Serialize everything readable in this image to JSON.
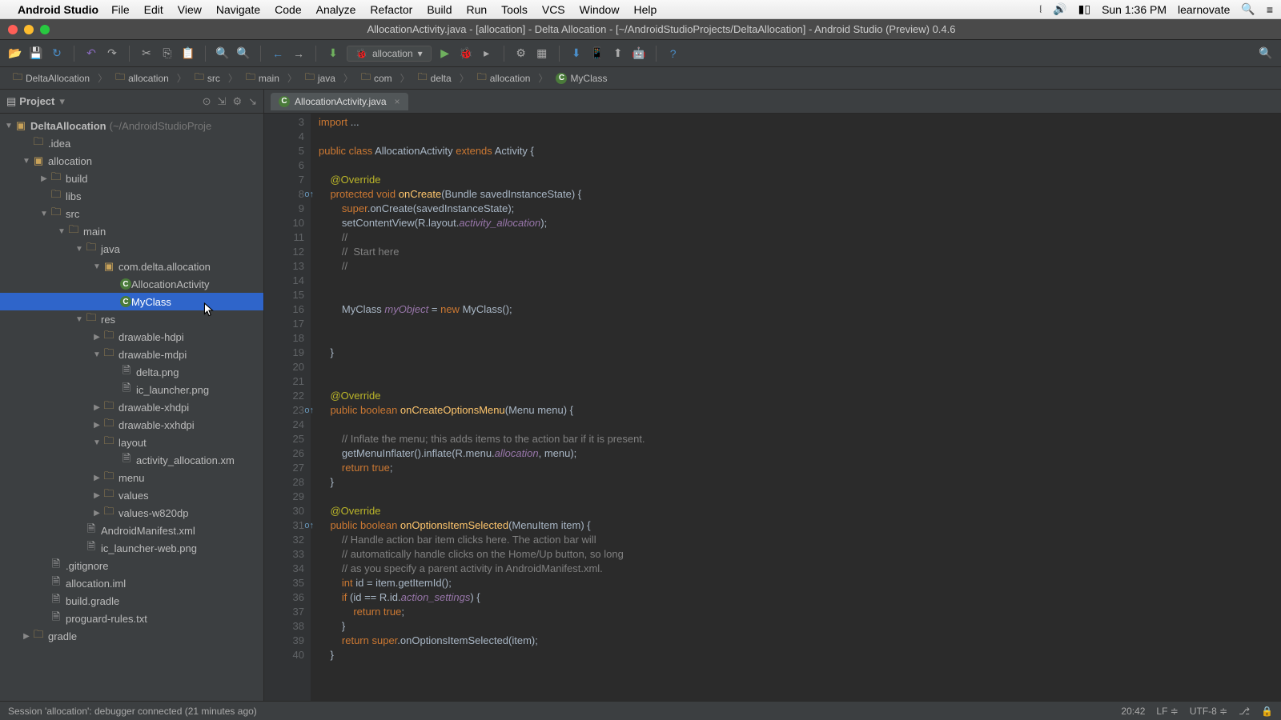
{
  "menubar": {
    "app": "Android Studio",
    "items": [
      "File",
      "Edit",
      "View",
      "Navigate",
      "Code",
      "Analyze",
      "Refactor",
      "Build",
      "Run",
      "Tools",
      "VCS",
      "Window",
      "Help"
    ],
    "clock": "Sun 1:36 PM",
    "user": "learnovate"
  },
  "window": {
    "title": "AllocationActivity.java - [allocation] - Delta Allocation - [~/AndroidStudioProjects/DeltaAllocation] - Android Studio (Preview) 0.4.6"
  },
  "toolbar": {
    "run_config": "allocation"
  },
  "breadcrumbs": [
    "DeltaAllocation",
    "allocation",
    "src",
    "main",
    "java",
    "com",
    "delta",
    "allocation",
    "MyClass"
  ],
  "project": {
    "panel_label": "Project",
    "root": "DeltaAllocation",
    "root_hint": "(~/AndroidStudioProje",
    "tree": [
      {
        "d": 1,
        "exp": null,
        "icon": "folder",
        "label": ".idea"
      },
      {
        "d": 1,
        "exp": "open",
        "icon": "module",
        "label": "allocation"
      },
      {
        "d": 2,
        "exp": "closed",
        "icon": "folder",
        "label": "build"
      },
      {
        "d": 2,
        "exp": null,
        "icon": "folder",
        "label": "libs"
      },
      {
        "d": 2,
        "exp": "open",
        "icon": "folder",
        "label": "src"
      },
      {
        "d": 3,
        "exp": "open",
        "icon": "folder",
        "label": "main"
      },
      {
        "d": 4,
        "exp": "open",
        "icon": "folder",
        "label": "java"
      },
      {
        "d": 5,
        "exp": "open",
        "icon": "pkg",
        "label": "com.delta.allocation"
      },
      {
        "d": 6,
        "exp": null,
        "icon": "class",
        "label": "AllocationActivity"
      },
      {
        "d": 6,
        "exp": null,
        "icon": "class",
        "label": "MyClass",
        "selected": true
      },
      {
        "d": 4,
        "exp": "open",
        "icon": "folder",
        "label": "res"
      },
      {
        "d": 5,
        "exp": "closed",
        "icon": "folder",
        "label": "drawable-hdpi"
      },
      {
        "d": 5,
        "exp": "open",
        "icon": "folder",
        "label": "drawable-mdpi"
      },
      {
        "d": 6,
        "exp": null,
        "icon": "file",
        "label": "delta.png"
      },
      {
        "d": 6,
        "exp": null,
        "icon": "file",
        "label": "ic_launcher.png"
      },
      {
        "d": 5,
        "exp": "closed",
        "icon": "folder",
        "label": "drawable-xhdpi"
      },
      {
        "d": 5,
        "exp": "closed",
        "icon": "folder",
        "label": "drawable-xxhdpi"
      },
      {
        "d": 5,
        "exp": "open",
        "icon": "folder",
        "label": "layout"
      },
      {
        "d": 6,
        "exp": null,
        "icon": "file",
        "label": "activity_allocation.xm"
      },
      {
        "d": 5,
        "exp": "closed",
        "icon": "folder",
        "label": "menu"
      },
      {
        "d": 5,
        "exp": "closed",
        "icon": "folder",
        "label": "values"
      },
      {
        "d": 5,
        "exp": "closed",
        "icon": "folder",
        "label": "values-w820dp"
      },
      {
        "d": 4,
        "exp": null,
        "icon": "file",
        "label": "AndroidManifest.xml"
      },
      {
        "d": 4,
        "exp": null,
        "icon": "file",
        "label": "ic_launcher-web.png"
      },
      {
        "d": 2,
        "exp": null,
        "icon": "file",
        "label": ".gitignore"
      },
      {
        "d": 2,
        "exp": null,
        "icon": "file",
        "label": "allocation.iml"
      },
      {
        "d": 2,
        "exp": null,
        "icon": "file",
        "label": "build.gradle"
      },
      {
        "d": 2,
        "exp": null,
        "icon": "file",
        "label": "proguard-rules.txt"
      },
      {
        "d": 1,
        "exp": "closed",
        "icon": "folder",
        "label": "gradle"
      }
    ]
  },
  "editor": {
    "tab_label": "AllocationActivity.java",
    "first_line": 3,
    "lines": [
      {
        "t": "import",
        "content": [
          [
            "kw",
            "import "
          ],
          [
            "plain",
            "..."
          ]
        ]
      },
      {
        "t": "blank"
      },
      {
        "t": "code",
        "content": [
          [
            "kw",
            "public class "
          ],
          [
            "plain",
            "AllocationActivity "
          ],
          [
            "kw",
            "extends "
          ],
          [
            "plain",
            "Activity {"
          ]
        ]
      },
      {
        "t": "blank"
      },
      {
        "t": "code",
        "indent": 1,
        "content": [
          [
            "ann",
            "@Override"
          ]
        ]
      },
      {
        "t": "code",
        "indent": 1,
        "marker": "o",
        "content": [
          [
            "kw",
            "protected void "
          ],
          [
            "fn",
            "onCreate"
          ],
          [
            "plain",
            "(Bundle savedInstanceState) {"
          ]
        ]
      },
      {
        "t": "code",
        "indent": 2,
        "content": [
          [
            "kw",
            "super"
          ],
          [
            "plain",
            ".onCreate(savedInstanceState);"
          ]
        ]
      },
      {
        "t": "code",
        "indent": 2,
        "content": [
          [
            "plain",
            "setContentView(R.layout."
          ],
          [
            "const",
            "activity_allocation"
          ],
          [
            "plain",
            ");"
          ]
        ]
      },
      {
        "t": "code",
        "indent": 2,
        "content": [
          [
            "cm",
            "//"
          ]
        ]
      },
      {
        "t": "code",
        "indent": 2,
        "content": [
          [
            "cm",
            "//  Start here"
          ]
        ]
      },
      {
        "t": "code",
        "indent": 2,
        "content": [
          [
            "cm",
            "//"
          ]
        ]
      },
      {
        "t": "blank"
      },
      {
        "t": "blank"
      },
      {
        "t": "code",
        "indent": 2,
        "content": [
          [
            "plain",
            "MyClass "
          ],
          [
            "var",
            "myObject"
          ],
          [
            "plain",
            " = "
          ],
          [
            "kw",
            "new "
          ],
          [
            "plain",
            "MyClass();"
          ]
        ]
      },
      {
        "t": "blank"
      },
      {
        "t": "blank"
      },
      {
        "t": "code",
        "indent": 1,
        "content": [
          [
            "plain",
            "}"
          ]
        ]
      },
      {
        "t": "blank"
      },
      {
        "t": "blank"
      },
      {
        "t": "code",
        "indent": 1,
        "content": [
          [
            "ann",
            "@Override"
          ]
        ]
      },
      {
        "t": "code",
        "indent": 1,
        "marker": "o",
        "content": [
          [
            "kw",
            "public boolean "
          ],
          [
            "fn",
            "onCreateOptionsMenu"
          ],
          [
            "plain",
            "(Menu menu) {"
          ]
        ]
      },
      {
        "t": "blank"
      },
      {
        "t": "code",
        "indent": 2,
        "content": [
          [
            "cm",
            "// Inflate the menu; this adds items to the action bar if it is present."
          ]
        ]
      },
      {
        "t": "code",
        "indent": 2,
        "content": [
          [
            "plain",
            "getMenuInflater().inflate(R.menu."
          ],
          [
            "const",
            "allocation"
          ],
          [
            "plain",
            ", menu);"
          ]
        ]
      },
      {
        "t": "code",
        "indent": 2,
        "content": [
          [
            "kw",
            "return true"
          ],
          [
            "plain",
            ";"
          ]
        ]
      },
      {
        "t": "code",
        "indent": 1,
        "content": [
          [
            "plain",
            "}"
          ]
        ]
      },
      {
        "t": "blank"
      },
      {
        "t": "code",
        "indent": 1,
        "content": [
          [
            "ann",
            "@Override"
          ]
        ]
      },
      {
        "t": "code",
        "indent": 1,
        "marker": "o",
        "content": [
          [
            "kw",
            "public boolean "
          ],
          [
            "fn",
            "onOptionsItemSelected"
          ],
          [
            "plain",
            "(MenuItem item) {"
          ]
        ]
      },
      {
        "t": "code",
        "indent": 2,
        "content": [
          [
            "cm",
            "// Handle action bar item clicks here. The action bar will"
          ]
        ]
      },
      {
        "t": "code",
        "indent": 2,
        "content": [
          [
            "cm",
            "// automatically handle clicks on the Home/Up button, so long"
          ]
        ]
      },
      {
        "t": "code",
        "indent": 2,
        "content": [
          [
            "cm",
            "// as you specify a parent activity in AndroidManifest.xml."
          ]
        ]
      },
      {
        "t": "code",
        "indent": 2,
        "content": [
          [
            "kw",
            "int "
          ],
          [
            "plain",
            "id = item.getItemId();"
          ]
        ]
      },
      {
        "t": "code",
        "indent": 2,
        "content": [
          [
            "kw",
            "if "
          ],
          [
            "plain",
            "(id == R.id."
          ],
          [
            "const",
            "action_settings"
          ],
          [
            "plain",
            ") {"
          ]
        ]
      },
      {
        "t": "code",
        "indent": 3,
        "content": [
          [
            "kw",
            "return true"
          ],
          [
            "plain",
            ";"
          ]
        ]
      },
      {
        "t": "code",
        "indent": 2,
        "content": [
          [
            "plain",
            "}"
          ]
        ]
      },
      {
        "t": "code",
        "indent": 2,
        "content": [
          [
            "kw",
            "return super"
          ],
          [
            "plain",
            ".onOptionsItemSelected(item);"
          ]
        ]
      },
      {
        "t": "code",
        "indent": 1,
        "content": [
          [
            "plain",
            "}"
          ]
        ]
      }
    ]
  },
  "statusbar": {
    "msg": "Session 'allocation': debugger connected (21 minutes ago)",
    "pos": "20:42",
    "line_sep": "LF",
    "encoding": "UTF-8"
  }
}
